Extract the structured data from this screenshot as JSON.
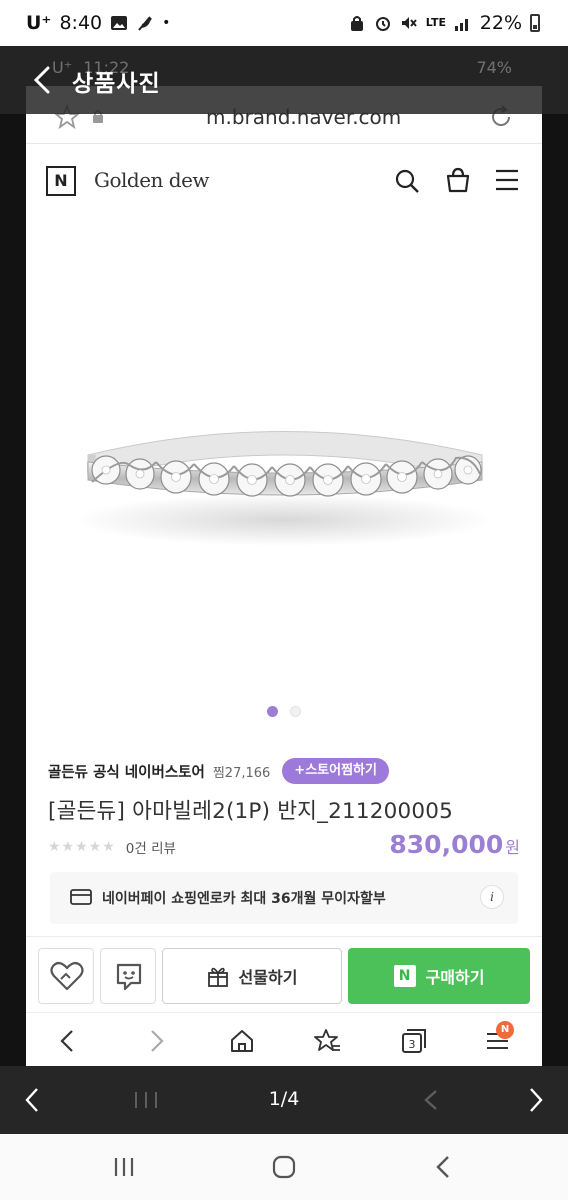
{
  "status_bar": {
    "carrier": "U⁺",
    "time": "8:40",
    "network": "LTE",
    "battery": "22%"
  },
  "viewer": {
    "title": "상품사진",
    "page_counter": "1/4"
  },
  "embedded_status": {
    "carrier": "U⁺",
    "time": "11:22",
    "battery": "74%"
  },
  "browser": {
    "url": "m.brand.naver.com"
  },
  "brand": {
    "logo_letter": "N",
    "name": "Golden dew"
  },
  "product": {
    "store_name": "골든듀 공식 네이버스토어",
    "store_favorites": "찜27,166",
    "store_follow_button": "+스토어찜하기",
    "title": "[골든듀] 아마빌레2(1P) 반지_211200005",
    "stars": "★★★★★",
    "review_count": "0건 리뷰",
    "price": "830,000",
    "price_unit": "원",
    "image_count": 2,
    "active_image_index": 1
  },
  "payment_info": {
    "text": "네이버페이 쇼핑엔로카 최대 36개월 무이자할부",
    "info_glyph": "i"
  },
  "actions": {
    "gift_label": "선물하기",
    "buy_logo": "N",
    "buy_label": "구매하기"
  },
  "browser_nav": {
    "tabs_count": "3",
    "menu_badge": "N"
  },
  "colors": {
    "accent_purple": "#9b7fd3",
    "buy_green": "#4dc159",
    "badge_orange": "#f06a3a"
  },
  "icons": [
    "photo-icon",
    "feather-icon",
    "lock-icon",
    "alarm-icon",
    "mute-icon",
    "signal-icon",
    "battery-icon",
    "back-icon",
    "star-icon",
    "reload-icon",
    "search-icon",
    "bag-icon",
    "menu-icon",
    "card-icon",
    "info-icon",
    "heart-icon",
    "talk-icon",
    "gift-icon",
    "chevron-left-icon",
    "chevron-right-icon",
    "home-icon",
    "bookmark-icon",
    "tabs-icon",
    "recents-icon",
    "circle-home-icon"
  ]
}
